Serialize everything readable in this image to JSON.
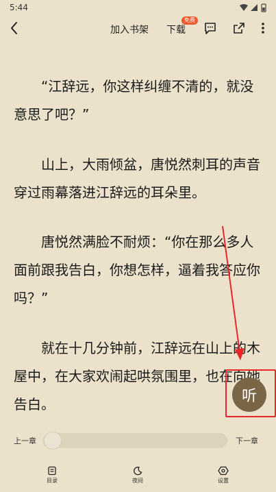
{
  "status": {
    "time": "5:44"
  },
  "toolbar": {
    "add_to_shelf": "加入书架",
    "download": "下载",
    "free_badge": "免费"
  },
  "reader": {
    "paragraphs": [
      "“江辞远，你这样纠缠不清的，就没意思了吧？”",
      "山上，大雨倾盆，唐悦然刺耳的声音穿过雨幕落进江辞远的耳朵里。",
      "唐悦然满脸不耐烦：“你在那么多人面前跟我告白，你想怎样，逼着我答应你吗？”",
      "就在十几分钟前，江辞远在山上的木屋中，在大家欢闹起哄氛围里，也在向她告白。"
    ]
  },
  "listen_button": {
    "label": "听"
  },
  "chapter_nav": {
    "prev_label": "上一章",
    "next_label": "下一章",
    "progress": 0
  },
  "bottom_nav": {
    "items": [
      {
        "label": "目录",
        "icon": "catalog-icon"
      },
      {
        "label": "夜间",
        "icon": "moon-icon"
      },
      {
        "label": "设置",
        "icon": "settings-icon"
      }
    ]
  },
  "colors": {
    "background": "#ece2cb",
    "listen_button": "#7a6547",
    "annotation": "#e8262a",
    "free_badge": "#ef5a2c"
  }
}
